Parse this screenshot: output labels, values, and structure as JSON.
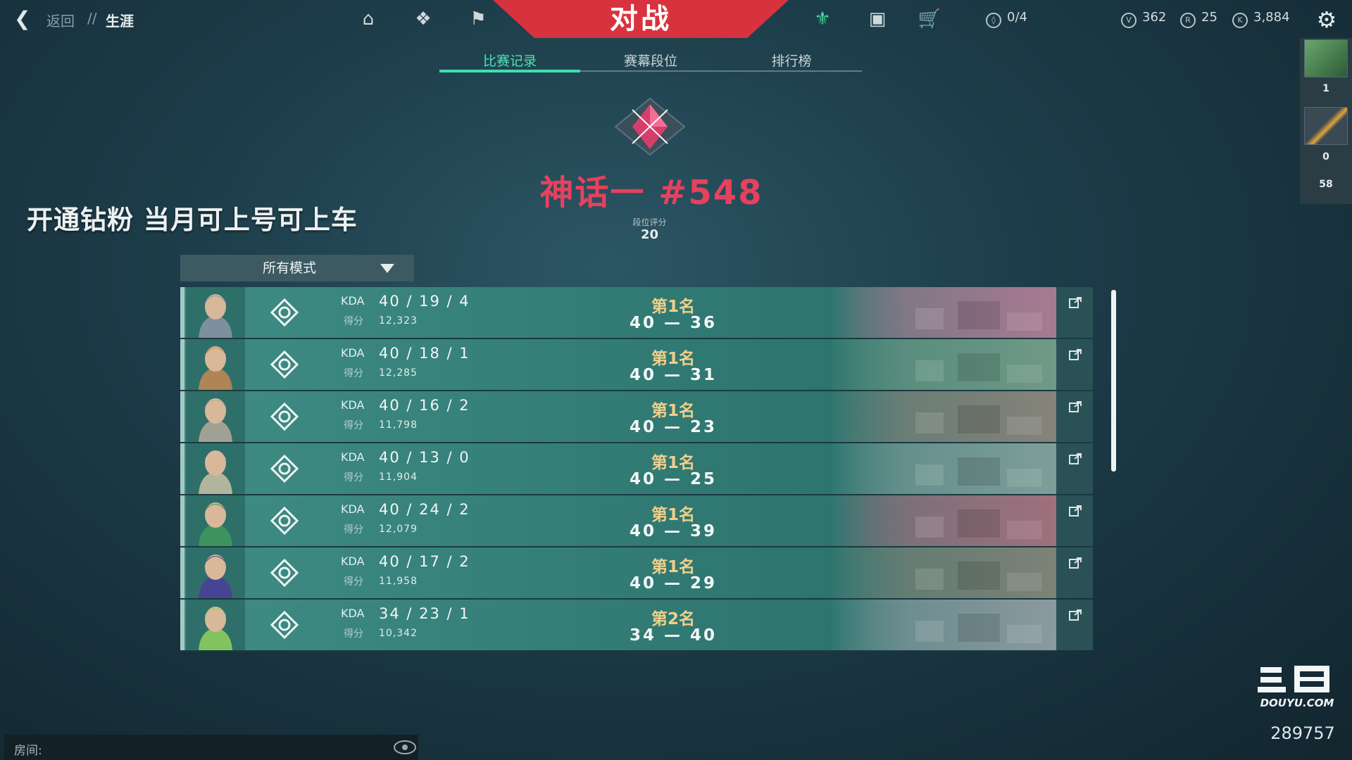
{
  "header": {
    "back_label": "返回",
    "separator": "//",
    "current": "生涯",
    "banner": "对战",
    "counters": {
      "missions": "0/4",
      "vp_value": "362",
      "radianite": "25",
      "kingdom_credits": "3,884"
    }
  },
  "tabs": [
    {
      "label": "比赛记录",
      "active": true
    },
    {
      "label": "赛幕段位",
      "active": false
    },
    {
      "label": "排行榜",
      "active": false
    }
  ],
  "rank": {
    "name": "神话一 #548",
    "score_label": "段位评分",
    "score": "20"
  },
  "promo_text": "开通钻粉 当月可上号可上车",
  "filter": {
    "selected": "所有模式"
  },
  "sidebar": {
    "values": [
      "1",
      "0",
      "58"
    ]
  },
  "matches": [
    {
      "kda": "40 / 19 / 4",
      "score": "12,323",
      "place": "第1名",
      "result": "40 — 36",
      "agent_color": "#8a96a6",
      "map_color": "#a87a92"
    },
    {
      "kda": "40 / 18 / 1",
      "score": "12,285",
      "place": "第1名",
      "result": "40 — 31",
      "agent_color": "#c68a52",
      "map_color": "#6f9a86"
    },
    {
      "kda": "40 / 16 / 2",
      "score": "11,798",
      "place": "第1名",
      "result": "40 — 23",
      "agent_color": "#b4aa9c",
      "map_color": "#86837a"
    },
    {
      "kda": "40 / 13 / 0",
      "score": "11,904",
      "place": "第1名",
      "result": "40 — 25",
      "agent_color": "#c9c2a4",
      "map_color": "#7f9e9a"
    },
    {
      "kda": "40 / 24 / 2",
      "score": "12,079",
      "place": "第1名",
      "result": "40 — 39",
      "agent_color": "#3f9a5a",
      "map_color": "#a0707e"
    },
    {
      "kda": "40 / 17 / 2",
      "score": "11,958",
      "place": "第1名",
      "result": "40 — 29",
      "agent_color": "#4a3d9a",
      "map_color": "#7d8276"
    },
    {
      "kda": "34 / 23 / 1",
      "score": "10,342",
      "place": "第2名",
      "result": "34 — 40",
      "agent_color": "#8fd45c",
      "map_color": "#8a9aa0"
    }
  ],
  "row_labels": {
    "kda": "KDA",
    "score": "得分"
  },
  "bottom": {
    "room_label": "房间:"
  },
  "watermark": {
    "site": "DOUYU.COM",
    "number": "289757"
  },
  "colors": {
    "accent": "#3fe0ae",
    "banner": "#d8323f",
    "rank": "#e6415e",
    "place": "#f1cf8a"
  }
}
